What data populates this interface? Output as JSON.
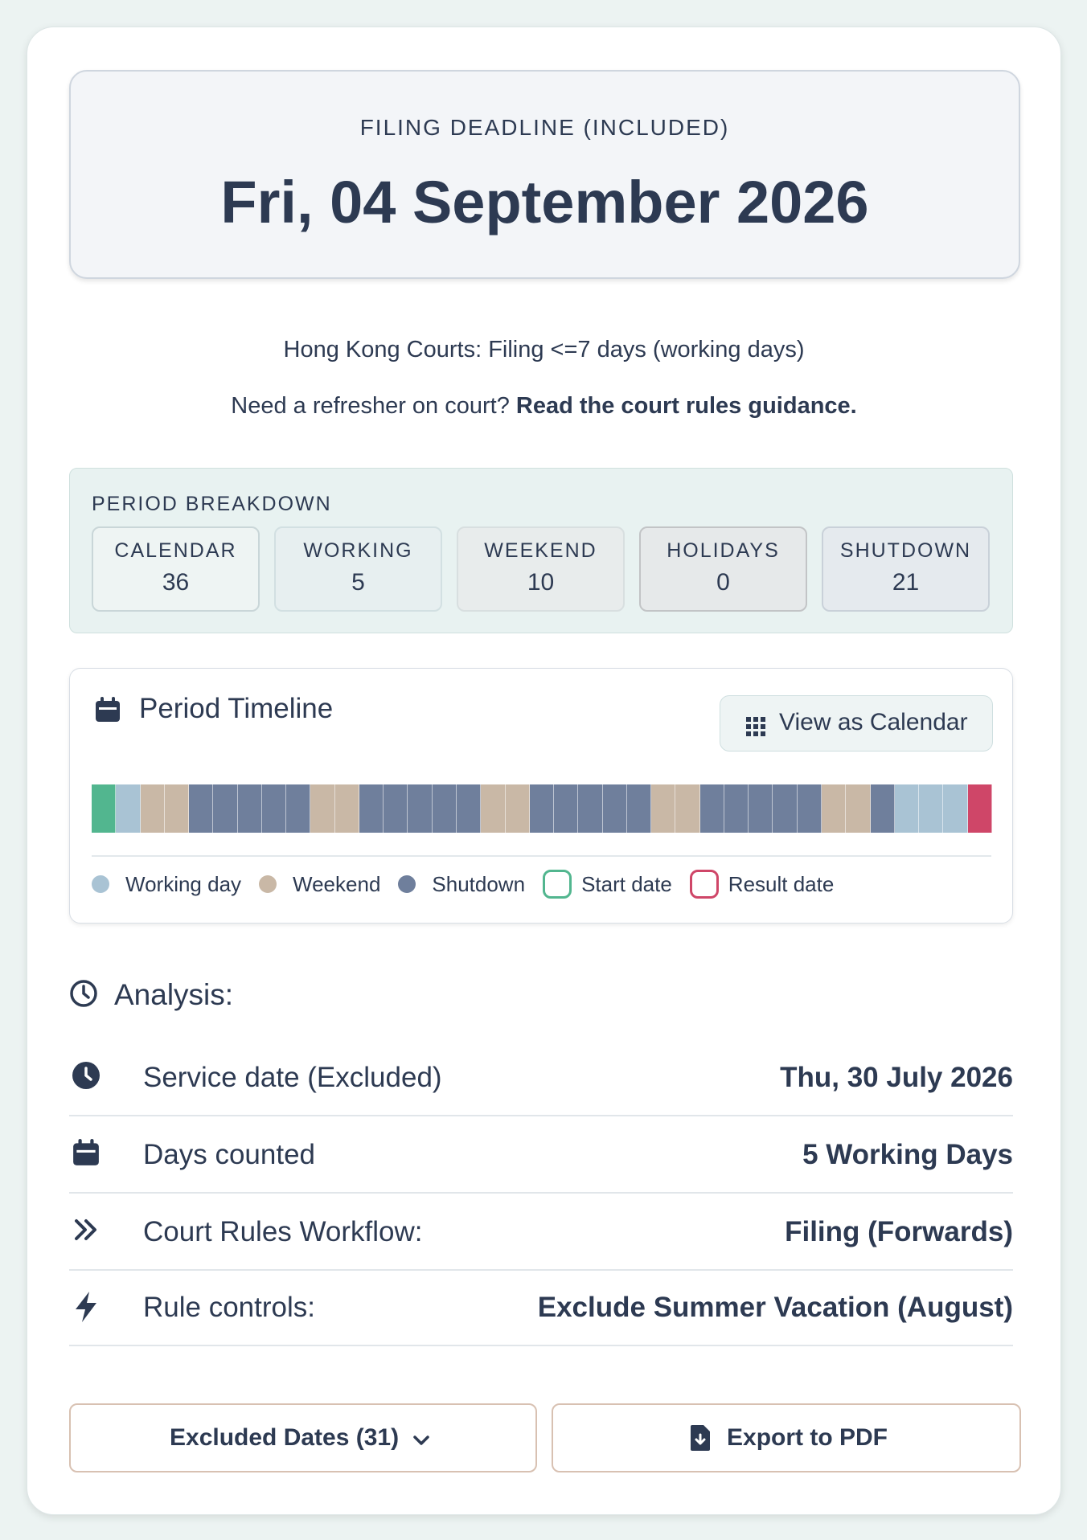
{
  "result": {
    "label": "FILING DEADLINE (INCLUDED)",
    "date": "Fri, 04 September 2026"
  },
  "rule_text": "Hong Kong Courts: Filing <=7 days (working days)",
  "refresher": {
    "prefix": "Need a refresher on court? ",
    "link": "Read the court rules guidance."
  },
  "breakdown": {
    "title": "PERIOD BREAKDOWN",
    "stats": [
      {
        "label": "CALENDAR",
        "value": "36"
      },
      {
        "label": "WORKING",
        "value": "5"
      },
      {
        "label": "WEEKEND",
        "value": "10"
      },
      {
        "label": "HOLIDAYS",
        "value": "0"
      },
      {
        "label": "SHUTDOWN",
        "value": "21"
      }
    ]
  },
  "timeline": {
    "title": "Period Timeline",
    "view_button": "View as Calendar",
    "days": [
      "start",
      "working",
      "weekend",
      "weekend",
      "shutdown",
      "shutdown",
      "shutdown",
      "shutdown",
      "shutdown",
      "weekend",
      "weekend",
      "shutdown",
      "shutdown",
      "shutdown",
      "shutdown",
      "shutdown",
      "weekend",
      "weekend",
      "shutdown",
      "shutdown",
      "shutdown",
      "shutdown",
      "shutdown",
      "weekend",
      "weekend",
      "shutdown",
      "shutdown",
      "shutdown",
      "shutdown",
      "shutdown",
      "weekend",
      "weekend",
      "shutdown",
      "working",
      "working",
      "working",
      "result"
    ],
    "colors": {
      "start": "#52b68f",
      "working": "#a9c3d4",
      "weekend": "#c9b8a6",
      "shutdown": "#6f7f9c",
      "result": "#cf4668"
    },
    "legend": [
      {
        "label": "Working day",
        "type": "dot",
        "color": "#a9c3d4"
      },
      {
        "label": "Weekend",
        "type": "dot",
        "color": "#c9b8a6"
      },
      {
        "label": "Shutdown",
        "type": "dot",
        "color": "#6f7f9c"
      },
      {
        "label": "Start date",
        "type": "ring",
        "color": "#52b68f"
      },
      {
        "label": "Result date",
        "type": "ring",
        "color": "#cf4668"
      }
    ]
  },
  "analysis": {
    "title": "Analysis:",
    "rows": [
      {
        "icon": "clock-icon",
        "label": "Service date (Excluded)",
        "value": "Thu, 30 July 2026"
      },
      {
        "icon": "calendar-icon",
        "label": "Days counted",
        "value": "5 Working Days"
      },
      {
        "icon": "double-chevron-right-icon",
        "label": "Court Rules Workflow:",
        "value": "Filing (Forwards)"
      },
      {
        "icon": "bolt-icon",
        "label": "Rule controls:",
        "value": "Exclude Summer Vacation (August)"
      }
    ]
  },
  "buttons": {
    "excluded": "Excluded Dates (31)",
    "export": "Export to PDF"
  }
}
